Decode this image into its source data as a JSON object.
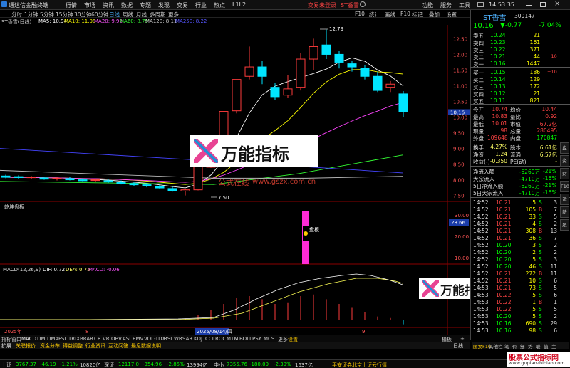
{
  "titlebar": {
    "app_name": "通达信金融终端",
    "menus": [
      "行情",
      "市场",
      "资讯",
      "数据",
      "专题",
      "发现",
      "交易",
      "行业",
      "热点",
      "L1L2"
    ],
    "login_status": "交易未登录",
    "stock_tag": "ST香雪",
    "tools": [
      "功能",
      "服务",
      "工具"
    ],
    "time": "14:53:35"
  },
  "periodbar": {
    "periods": [
      "分时",
      "1分钟",
      "5分钟",
      "15分钟",
      "30分钟",
      "60分钟",
      "日线",
      "周线",
      "月线",
      "多周期",
      "更多"
    ],
    "right_tools": [
      "F10",
      "统计",
      "画线",
      "F10",
      "标记",
      "叠加",
      "设置"
    ]
  },
  "ma_legend": {
    "title": "ST香雪(日线)",
    "items": [
      {
        "text": "MA5: 10.94",
        "color": "#ffffff"
      },
      {
        "text": "MA10: 11.08",
        "color": "#ffff00"
      },
      {
        "text": "MA20: 9.92",
        "color": "#ff00ff"
      },
      {
        "text": "MA60: 8.79",
        "color": "#00ff00"
      },
      {
        "text": "MA120: 8.11",
        "color": "#cccccc"
      },
      {
        "text": "MA250: 8.22",
        "color": "#4444ff"
      }
    ]
  },
  "price_axis": [
    "12.50",
    "12.00",
    "11.50",
    "11.00",
    "10.50",
    "10.00",
    "9.50",
    "9.00",
    "8.50",
    "8.00",
    "7.50"
  ],
  "annotations": {
    "high": "12.79",
    "low": "7.50"
  },
  "indicator2": {
    "title": "乾坤盘板",
    "label": "盘板",
    "axis": [
      "30.00",
      "20.00",
      "10.00"
    ],
    "current": "28.66"
  },
  "macd": {
    "title": "MACD(12,26,9)",
    "dif": "DIF: 0.72",
    "dea": "DEA: 0.75",
    "macd": "MACD: -0.06"
  },
  "date_axis": {
    "left": "2025年",
    "mid_date": "2025/08/14/四",
    "right": "9",
    "left_month": "8"
  },
  "tabbar": {
    "items": [
      "指标",
      "窗口",
      "MACD",
      "DMI",
      "DMA",
      "FSL",
      "TRIX",
      "BRAR",
      "CR",
      "VR",
      "OBV",
      "ASI",
      "EMV",
      "VOL-TDX",
      "RSI",
      "WR",
      "SAR",
      "KDJ",
      "CCI",
      "ROC",
      "MTM",
      "BOLL",
      "PSY",
      "MCST",
      "更多",
      "设置"
    ],
    "right": [
      "模板",
      "+"
    ]
  },
  "toolbar2": {
    "items": [
      "扩展",
      "关联报价",
      "资金分布",
      "得益调整",
      "行业资讯",
      "互动问答",
      "最息数据说明"
    ],
    "right": "日线"
  },
  "rightpanel": {
    "stock_name": "ST香雪",
    "stock_code": "300147",
    "price": "10.16",
    "change": "▼-0.77",
    "change_pct": "-7.04%",
    "asks": [
      {
        "label": "卖五",
        "price": "10.24",
        "vol": "21",
        "flag": ""
      },
      {
        "label": "卖四",
        "price": "10.23",
        "vol": "161",
        "flag": ""
      },
      {
        "label": "卖三",
        "price": "10.22",
        "vol": "371",
        "flag": ""
      },
      {
        "label": "卖二",
        "price": "10.21",
        "vol": "44",
        "flag": "+10"
      },
      {
        "label": "卖一",
        "price": "10.16",
        "vol": "1447",
        "flag": ""
      }
    ],
    "bids": [
      {
        "label": "买一",
        "price": "10.15",
        "vol": "186",
        "flag": "+10"
      },
      {
        "label": "买二",
        "price": "10.14",
        "vol": "129",
        "flag": ""
      },
      {
        "label": "买三",
        "price": "10.13",
        "vol": "172",
        "flag": ""
      },
      {
        "label": "买四",
        "price": "10.12",
        "vol": "21",
        "flag": ""
      },
      {
        "label": "买五",
        "price": "10.11",
        "vol": "821",
        "flag": ""
      }
    ],
    "stats": [
      {
        "l1": "今开",
        "v1": "10.74",
        "l2": "均价",
        "v2": "10.44"
      },
      {
        "l1": "最高",
        "v1": "10.83",
        "l2": "量比",
        "v2": "0.92"
      },
      {
        "l1": "最低",
        "v1": "10.01",
        "l2": "市值",
        "v2": "67.2亿"
      },
      {
        "l1": "现量",
        "v1": "98",
        "l2": "总量",
        "v2": "280495"
      },
      {
        "l1": "外盘",
        "v1": "109648",
        "l2": "内盘",
        "v2": "170847"
      }
    ],
    "stats2": [
      {
        "l1": "换手",
        "v1": "4.27%",
        "l2": "股本",
        "v2": "6.61亿"
      },
      {
        "l1": "净资",
        "v1": "1.24",
        "l2": "流通",
        "v2": "6.57亿"
      },
      {
        "l1": "收益(-)",
        "v1": "-0.350",
        "l2": "PE(动)",
        "v2": "-"
      }
    ],
    "flows": [
      {
        "label": "净流入额",
        "val": "-6269万",
        "pct": "-21%"
      },
      {
        "label": "大宗流入",
        "val": "-4710万",
        "pct": "-16%"
      },
      {
        "label": "5日净流入额",
        "val": "-6269万",
        "pct": "-21%"
      },
      {
        "label": "5日大宗流入",
        "val": "-4710万",
        "pct": "-16%"
      }
    ],
    "ticks": [
      {
        "t": "14:52",
        "p": "10.21",
        "v": "5",
        "s": "S",
        "n": "3"
      },
      {
        "t": "14:52",
        "p": "10.21",
        "v": "105",
        "s": "B",
        "n": "7"
      },
      {
        "t": "14:52",
        "p": "10.21",
        "v": "33",
        "s": "S",
        "n": "5"
      },
      {
        "t": "14:52",
        "p": "10.21",
        "v": "4",
        "s": "S",
        "n": "2"
      },
      {
        "t": "14:52",
        "p": "10.21",
        "v": "308",
        "s": "B",
        "n": "13"
      },
      {
        "t": "14:52",
        "p": "10.21",
        "v": "36",
        "s": "S",
        "n": "7"
      },
      {
        "t": "14:52",
        "p": "10.20",
        "v": "3",
        "s": "S",
        "n": "2"
      },
      {
        "t": "14:52",
        "p": "10.20",
        "v": "2",
        "s": "S",
        "n": "2"
      },
      {
        "t": "14:52",
        "p": "10.20",
        "v": "5",
        "s": "S",
        "n": "3"
      },
      {
        "t": "14:52",
        "p": "10.20",
        "v": "46",
        "s": "S",
        "n": "11"
      },
      {
        "t": "14:52",
        "p": "10.21",
        "v": "272",
        "s": "B",
        "n": "11"
      },
      {
        "t": "14:52",
        "p": "10.21",
        "v": "10",
        "s": "S",
        "n": "6"
      },
      {
        "t": "14:53",
        "p": "10.21",
        "v": "73",
        "s": "S",
        "n": "5"
      },
      {
        "t": "14:53",
        "p": "10.22",
        "v": "5",
        "s": "S",
        "n": "6"
      },
      {
        "t": "14:53",
        "p": "10.22",
        "v": "1",
        "s": "B",
        "n": "1"
      },
      {
        "t": "14:53",
        "p": "10.22",
        "v": "5",
        "s": "S",
        "n": "5"
      },
      {
        "t": "14:53",
        "p": "10.20",
        "v": "5",
        "s": "S",
        "n": "2"
      },
      {
        "t": "14:53",
        "p": "10.16",
        "v": "690",
        "s": "S",
        "n": "29"
      },
      {
        "t": "14:53",
        "p": "10.16",
        "v": "98",
        "s": "S",
        "n": "6"
      }
    ],
    "side_tabs": [
      "盘",
      "资",
      "财",
      "F10",
      "运",
      "新",
      "股"
    ],
    "footer": [
      "图文F10",
      "其他栏",
      "笔",
      "价",
      "细",
      "势",
      "联",
      "值",
      "主"
    ]
  },
  "status": {
    "items": [
      {
        "label": "上证",
        "val": "3767.37",
        "chg": "-46.19",
        "pct": "-1.21%",
        "amt": "10820亿"
      },
      {
        "label": "深证",
        "val": "12117.0",
        "chg": "-354.96",
        "pct": "-2.85%",
        "amt": "13994亿"
      },
      {
        "label": "中小",
        "val": "7355.76",
        "chg": "-180.09",
        "pct": "-2.39%",
        "amt": "1637亿"
      }
    ],
    "broker": "平安证券北京上证云行情"
  },
  "overlay": {
    "brand": "万能指标",
    "watermark_cn": "公式在线",
    "watermark_url": "www.gszx.com.cn",
    "corner_title": "股票公式指标网",
    "corner_url": "www.gupiaozhibiao.com"
  },
  "chart_data": {
    "type": "candlestick",
    "title": "ST香雪(日线)",
    "ylim": [
      7.4,
      12.85
    ],
    "candles": [
      {
        "o": 8.12,
        "h": 8.16,
        "l": 8.05,
        "c": 8.08
      },
      {
        "o": 8.1,
        "h": 8.14,
        "l": 8.04,
        "c": 8.07
      },
      {
        "o": 8.08,
        "h": 8.12,
        "l": 8.03,
        "c": 8.09
      },
      {
        "o": 8.06,
        "h": 8.1,
        "l": 8.0,
        "c": 8.02
      },
      {
        "o": 8.03,
        "h": 8.08,
        "l": 7.98,
        "c": 8.05
      },
      {
        "o": 8.04,
        "h": 8.09,
        "l": 7.98,
        "c": 8.0
      },
      {
        "o": 8.0,
        "h": 8.05,
        "l": 7.95,
        "c": 7.97
      },
      {
        "o": 7.98,
        "h": 8.03,
        "l": 7.93,
        "c": 8.0
      },
      {
        "o": 7.97,
        "h": 8.02,
        "l": 7.9,
        "c": 7.93
      },
      {
        "o": 7.92,
        "h": 7.98,
        "l": 7.85,
        "c": 7.88
      },
      {
        "o": 7.88,
        "h": 7.93,
        "l": 7.8,
        "c": 7.84
      },
      {
        "o": 7.84,
        "h": 7.9,
        "l": 7.76,
        "c": 7.8
      },
      {
        "o": 7.78,
        "h": 7.84,
        "l": 7.72,
        "c": 7.74
      },
      {
        "o": 7.72,
        "h": 7.78,
        "l": 7.62,
        "c": 7.66
      },
      {
        "o": 7.64,
        "h": 7.7,
        "l": 7.5,
        "c": 7.68
      },
      {
        "o": 7.68,
        "h": 8.42,
        "l": 7.66,
        "c": 8.42
      },
      {
        "o": 8.4,
        "h": 9.26,
        "l": 8.38,
        "c": 9.26
      },
      {
        "o": 9.26,
        "h": 10.18,
        "l": 9.2,
        "c": 10.18
      },
      {
        "o": 10.2,
        "h": 11.2,
        "l": 10.12,
        "c": 11.2
      },
      {
        "o": 11.3,
        "h": 12.25,
        "l": 11.2,
        "c": 11.6
      },
      {
        "o": 11.6,
        "h": 11.8,
        "l": 11.05,
        "c": 11.3
      },
      {
        "o": 10.95,
        "h": 11.1,
        "l": 10.55,
        "c": 10.65
      },
      {
        "o": 10.7,
        "h": 11.35,
        "l": 10.62,
        "c": 10.9
      },
      {
        "o": 10.95,
        "h": 12.05,
        "l": 10.85,
        "c": 11.85
      },
      {
        "o": 11.85,
        "h": 12.5,
        "l": 11.5,
        "c": 12.25
      },
      {
        "o": 12.3,
        "h": 12.79,
        "l": 11.85,
        "c": 12.0
      },
      {
        "o": 12.0,
        "h": 12.1,
        "l": 11.55,
        "c": 11.75
      },
      {
        "o": 11.7,
        "h": 11.8,
        "l": 11.45,
        "c": 11.6
      },
      {
        "o": 11.55,
        "h": 11.65,
        "l": 11.2,
        "c": 11.3
      },
      {
        "o": 11.3,
        "h": 11.45,
        "l": 10.8,
        "c": 10.85
      },
      {
        "o": 10.95,
        "h": 11.15,
        "l": 10.8,
        "c": 11.05
      },
      {
        "o": 10.74,
        "h": 10.83,
        "l": 10.01,
        "c": 10.16
      }
    ]
  }
}
